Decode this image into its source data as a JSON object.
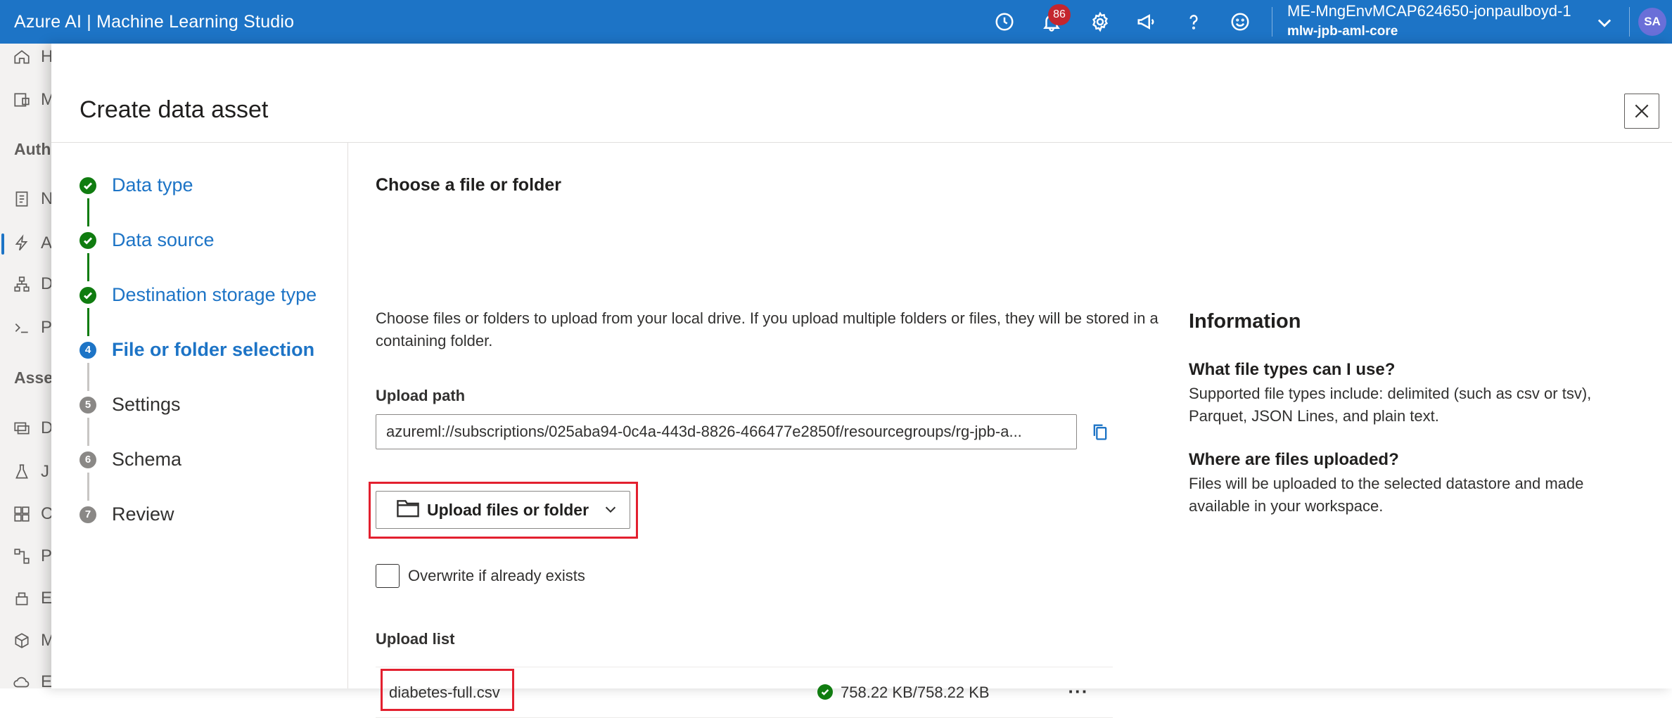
{
  "app": {
    "title": "Azure AI | Machine Learning Studio"
  },
  "header": {
    "notification_count": "86",
    "workspace_name": "ME-MngEnvMCAP624650-jonpaulboyd-1",
    "workspace_sub": "mlw-jpb-aml-core",
    "avatar_initials": "SA",
    "icons": [
      "history-icon",
      "bell-icon",
      "gear-icon",
      "megaphone-icon",
      "help-icon",
      "smiley-icon",
      "chevron-down-icon"
    ]
  },
  "background_nav": {
    "items": [
      {
        "icon": "home-icon",
        "label": "H"
      },
      {
        "icon": "model-catalog-icon",
        "label": "M"
      },
      {
        "icon": "notebook-icon",
        "label": "N"
      },
      {
        "icon": "automl-icon",
        "label": "A"
      },
      {
        "icon": "designer-icon",
        "label": "D"
      },
      {
        "icon": "prompt-flow-icon",
        "label": "P"
      },
      {
        "icon": "data-icon",
        "label": "D"
      },
      {
        "icon": "jobs-icon",
        "label": "J"
      },
      {
        "icon": "components-icon",
        "label": "C"
      },
      {
        "icon": "pipelines-icon",
        "label": "P"
      },
      {
        "icon": "environments-icon",
        "label": "E"
      },
      {
        "icon": "models-icon",
        "label": "M"
      },
      {
        "icon": "endpoints-icon",
        "label": "E"
      }
    ],
    "sections": [
      "Autho",
      "Asset"
    ]
  },
  "panel": {
    "title": "Create data asset",
    "steps": [
      {
        "number": "1",
        "label": "Data type",
        "status": "done"
      },
      {
        "number": "2",
        "label": "Data source",
        "status": "done"
      },
      {
        "number": "3",
        "label": "Destination storage type",
        "status": "done"
      },
      {
        "number": "4",
        "label": "File or folder selection",
        "status": "current"
      },
      {
        "number": "5",
        "label": "Settings",
        "status": "todo"
      },
      {
        "number": "6",
        "label": "Schema",
        "status": "todo"
      },
      {
        "number": "7",
        "label": "Review",
        "status": "todo"
      }
    ]
  },
  "main": {
    "section_title": "Choose a file or folder",
    "description": "Choose files or folders to upload from your local drive. If you upload multiple folders or files, they will be stored in a containing folder.",
    "upload_path_label": "Upload path",
    "upload_path_value": "azureml://subscriptions/025aba94-0c4a-443d-8826-466477e2850f/resourcegroups/rg-jpb-a...",
    "upload_button_label": "Upload files or folder",
    "overwrite_label": "Overwrite if already exists",
    "overwrite_checked": false,
    "upload_list_title": "Upload list",
    "files": [
      {
        "name": "diabetes-full.csv",
        "status": "758.22 KB/758.22 KB",
        "progress": 1.0
      }
    ]
  },
  "info": {
    "title": "Information",
    "q1": "What file types can I use?",
    "a1": "Supported file types include: delimited (such as csv or tsv), Parquet, JSON Lines, and plain text.",
    "q2": "Where are files uploaded?",
    "a2": "Files will be uploaded to the selected datastore and made available in your workspace."
  },
  "colors": {
    "topbar": "#1d74c6",
    "accent": "#1d74c6",
    "success": "#107c10",
    "highlight": "#e3202f",
    "badge": "#c4262e"
  }
}
